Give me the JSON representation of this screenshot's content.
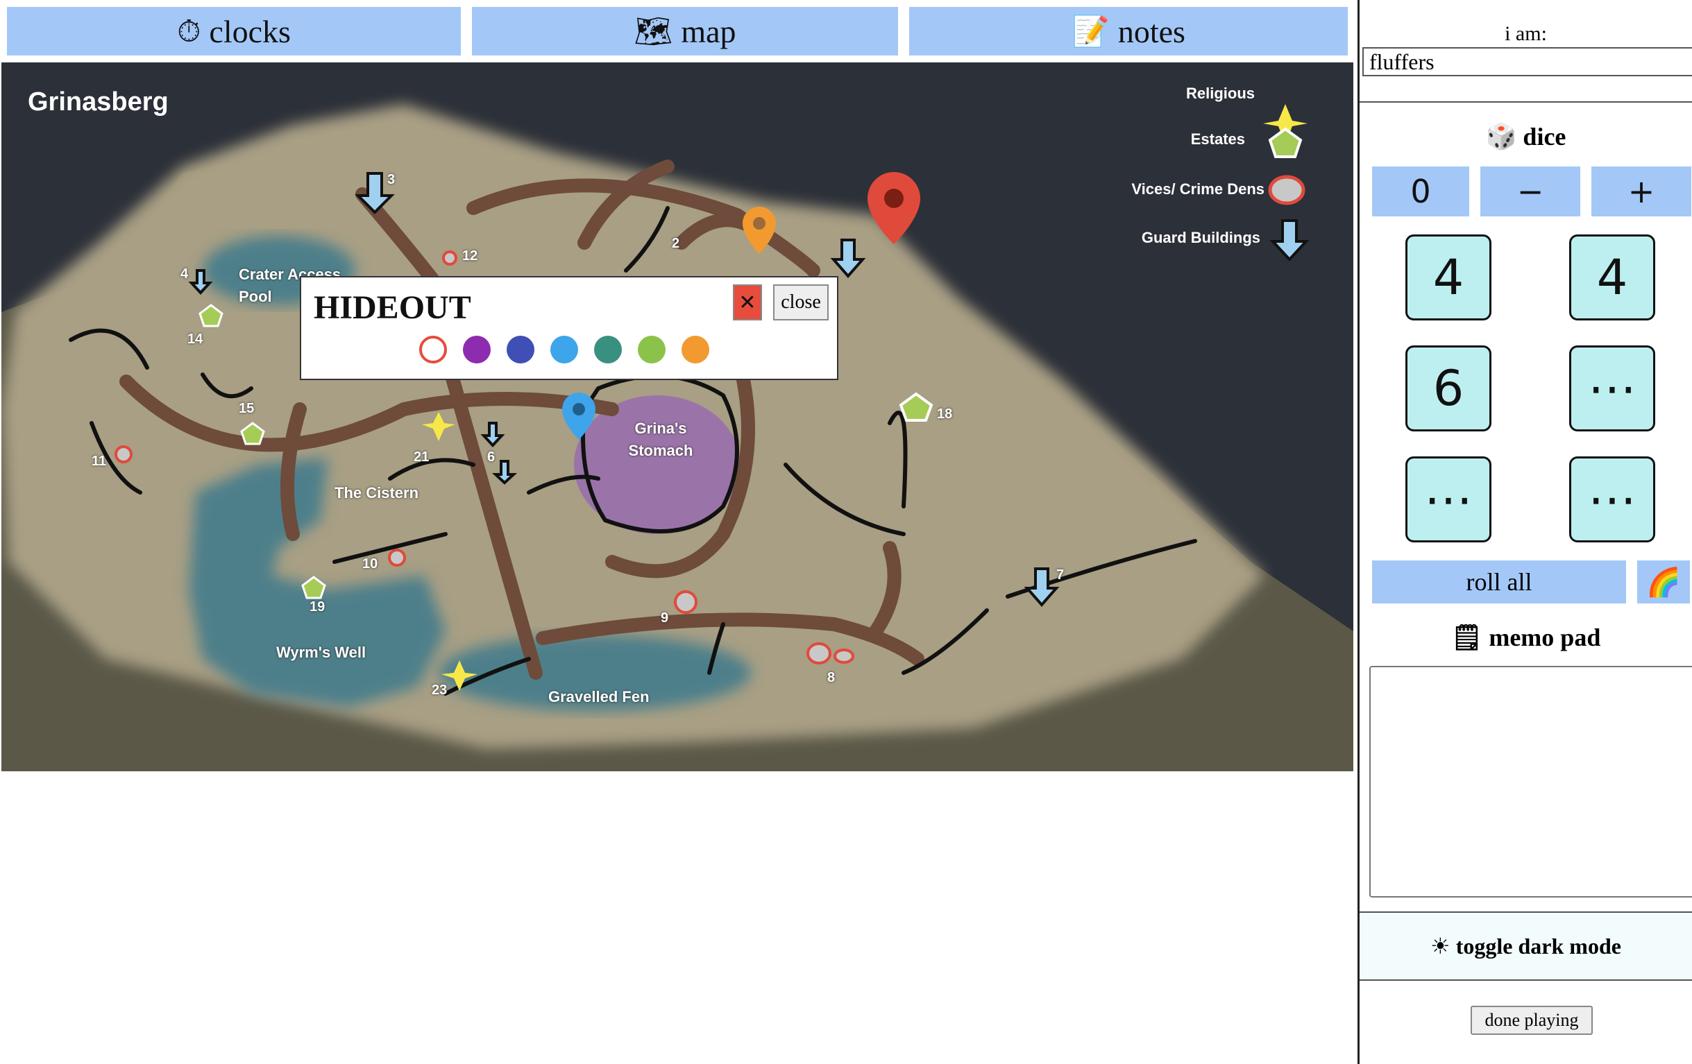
{
  "tabs": [
    {
      "icon": "⏱",
      "label": "clocks",
      "icon_name": "stopwatch-icon"
    },
    {
      "icon": "🗺",
      "label": "map",
      "icon_name": "map-icon"
    },
    {
      "icon": "📝",
      "label": "notes",
      "icon_name": "memo-icon"
    }
  ],
  "map": {
    "title": "Grinasberg",
    "areas": [
      "Crater Access Pool",
      "The Cistern",
      "Wyrm's Well",
      "Gravelled Fen",
      "Grina's Stomach"
    ],
    "legend": [
      {
        "label": "Religious",
        "icon_name": "star-icon"
      },
      {
        "label": "Estates",
        "icon_name": "pentagon-icon"
      },
      {
        "label": "Vices/ Crime Dens",
        "icon_name": "ring-icon"
      },
      {
        "label": "Guard Buildings",
        "icon_name": "arrow-down-icon"
      }
    ],
    "markers": [
      "2",
      "3",
      "4",
      "6",
      "7",
      "8",
      "9",
      "10",
      "11",
      "12",
      "14",
      "15",
      "18",
      "19",
      "21",
      "23"
    ],
    "colors": {
      "land": "#a89f84",
      "water": "#4d7f8a",
      "road": "#6e4b3a",
      "sky": "#2c3038",
      "stomach": "#9a74a8"
    }
  },
  "popup": {
    "title": "HIDEOUT",
    "x_symbol": "✕",
    "close_label": "close",
    "swatches": [
      "#e74c3c",
      "#8e2cb0",
      "#3f4fb5",
      "#3ea5ea",
      "#3a9080",
      "#8bc34a",
      "#f29a30"
    ]
  },
  "sidebar": {
    "iam_label": "i am:",
    "name_value": "fluffers",
    "dice_icon": "🎲",
    "dice_label": "dice",
    "count": "0",
    "minus": "−",
    "plus": "+",
    "dice": [
      "4",
      "4",
      "6",
      "⋯",
      "⋯",
      "⋯"
    ],
    "roll_all": "roll all",
    "rainbow": "🌈",
    "memo_icon": "🗒",
    "memo_label": "memo pad",
    "memo_value": "",
    "dark_icon": "☀",
    "dark_label": "toggle dark mode",
    "done_label": "done playing"
  }
}
